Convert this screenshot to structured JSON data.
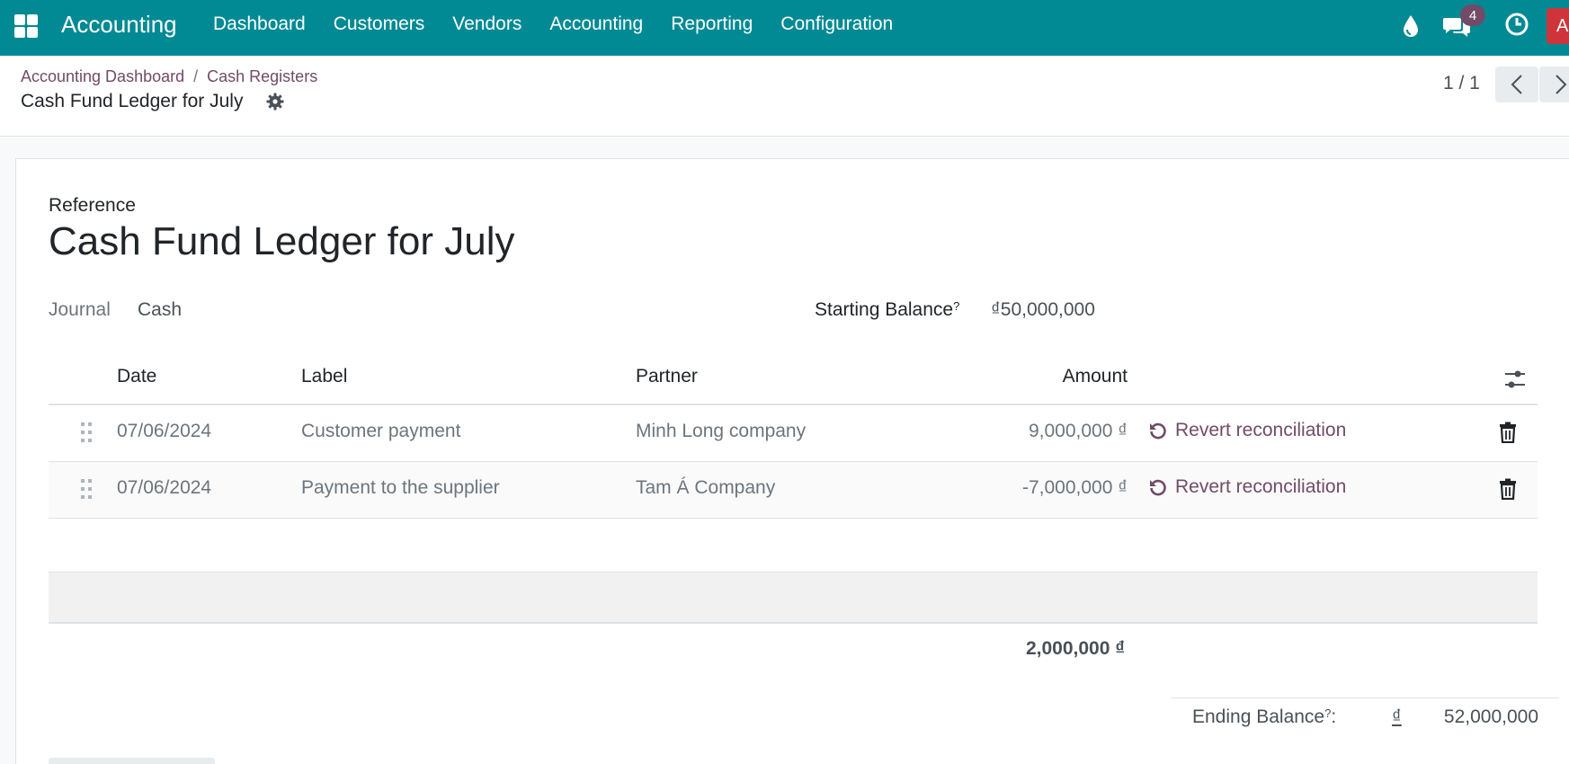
{
  "navbar": {
    "app_name": "Accounting",
    "menu": [
      "Dashboard",
      "Customers",
      "Vendors",
      "Accounting",
      "Reporting",
      "Configuration"
    ],
    "chat_badge": "4",
    "avatar_initial": "A",
    "icons": [
      "apps-icon",
      "drop-icon",
      "chat-icon",
      "clock-icon"
    ]
  },
  "breadcrumb": {
    "items": [
      "Accounting Dashboard",
      "Cash Registers"
    ],
    "separator": "/",
    "current": "Cash Fund Ledger for July"
  },
  "pager": {
    "value": "1 / 1"
  },
  "form": {
    "reference_label": "Reference",
    "reference_value": "Cash Fund Ledger for July",
    "journal_label": "Journal",
    "journal_value": "Cash",
    "starting_balance_label": "Starting Balance",
    "starting_balance_value": "₫50,000,000",
    "help_mark": "?"
  },
  "table": {
    "columns": [
      "Date",
      "Label",
      "Partner",
      "Amount"
    ],
    "rows": [
      {
        "date": "07/06/2024",
        "label": "Customer payment",
        "partner": "Minh Long company",
        "amount": "9,000,000 ₫",
        "action": "Revert reconciliation"
      },
      {
        "date": "07/06/2024",
        "label": "Payment to the supplier",
        "partner": "Tam Á Company",
        "amount": "-7,000,000 ₫",
        "action": "Revert reconciliation"
      }
    ],
    "total": "2,000,000 ₫"
  },
  "ending_balance": {
    "label": "Ending Balance",
    "help_mark": "?",
    "suffix": ":",
    "currency": "₫",
    "value": "52,000,000"
  },
  "colors": {
    "navbar": "#018a94",
    "accent": "#714b67",
    "avatar": "#d0343b"
  }
}
